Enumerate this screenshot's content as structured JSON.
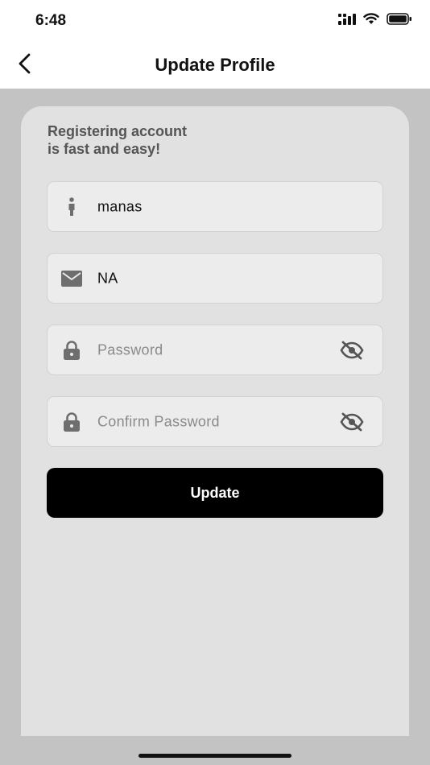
{
  "status_bar": {
    "time": "6:48",
    "icons": [
      "signal-icon",
      "wifi-icon",
      "battery-icon"
    ]
  },
  "nav": {
    "back_icon": "chevron-left-icon",
    "title": "Update Profile"
  },
  "form": {
    "intro": "Registering account is fast and easy!",
    "fields": [
      {
        "icon": "person-icon",
        "value": "manas",
        "placeholder": ""
      },
      {
        "icon": "mail-icon",
        "value": "NA",
        "placeholder": ""
      },
      {
        "icon": "lock-icon",
        "value": "",
        "placeholder": "Password",
        "toggle_icon": "eye-off-icon"
      },
      {
        "icon": "lock-icon",
        "value": "",
        "placeholder": "Confirm Password",
        "toggle_icon": "eye-off-icon"
      }
    ],
    "submit_label": "Update"
  },
  "colors": {
    "background": "#c3c3c3",
    "card": "#e1e1e1",
    "field": "#ececec",
    "button": "#000000",
    "icon_gray": "#6e6e6e"
  }
}
